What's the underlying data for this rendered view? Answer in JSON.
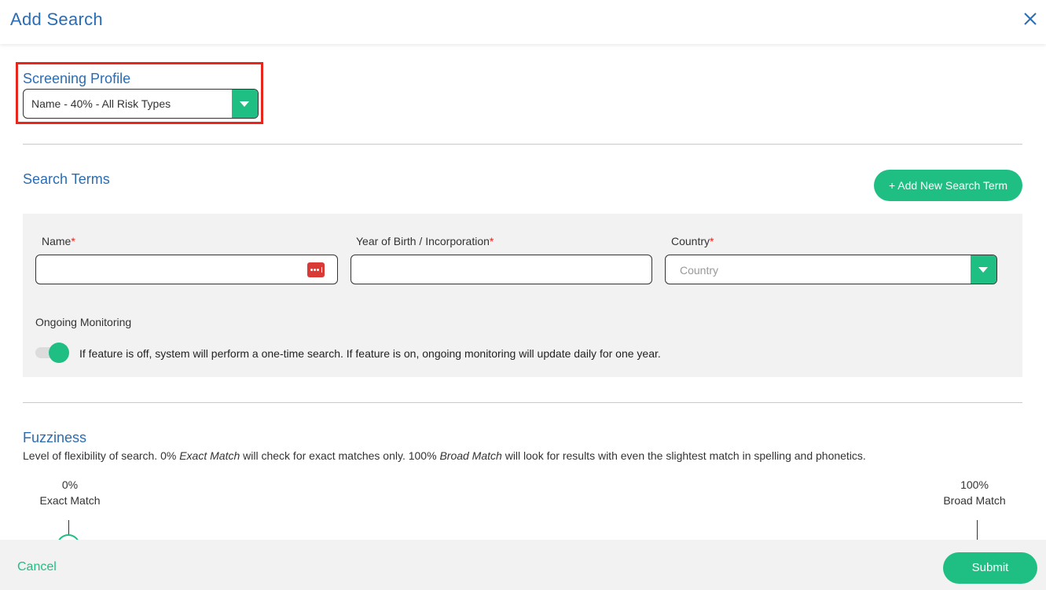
{
  "header": {
    "title": "Add Search",
    "close_icon": "close-icon"
  },
  "screening_profile": {
    "title": "Screening Profile",
    "selected": "Name - 40% - All Risk Types",
    "highlight_color": "#e8261c"
  },
  "search_terms": {
    "title": "Search Terms",
    "add_button": "+ Add New Search Term",
    "fields": {
      "name": {
        "label": "Name",
        "required_mark": "*",
        "value": "",
        "icon": "password-manager-icon"
      },
      "year": {
        "label": "Year of Birth / Incorporation",
        "required_mark": "*",
        "value": ""
      },
      "country": {
        "label": "Country",
        "required_mark": "*",
        "placeholder": "Country"
      }
    },
    "monitoring": {
      "label": "Ongoing Monitoring",
      "enabled": true,
      "description": "If feature is off, system will perform a one-time search. If feature is on, ongoing monitoring will update daily for one year."
    }
  },
  "fuzziness": {
    "title": "Fuzziness",
    "desc_1": "Level of flexibility of search. 0% ",
    "desc_exact": "Exact Match",
    "desc_2": " will check for exact matches only. 100% ",
    "desc_broad": "Broad Match",
    "desc_3": " will look for results with even the slightest match in spelling and phonetics.",
    "min_percent": "0%",
    "min_label": "Exact Match",
    "max_percent": "100%",
    "max_label": "Broad Match",
    "value_percent": 0
  },
  "footer": {
    "cancel": "Cancel",
    "submit": "Submit"
  },
  "colors": {
    "accent": "#1fbf83",
    "title_blue": "#2a6db5",
    "required": "#e8261c"
  }
}
